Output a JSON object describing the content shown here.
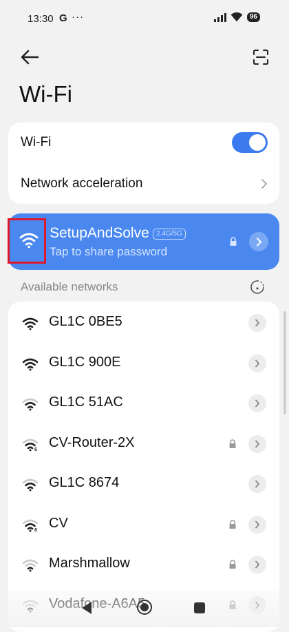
{
  "status_bar": {
    "time": "13:30",
    "carrier_icon": "G",
    "more": "···",
    "battery": "96"
  },
  "header": {
    "back_icon": "arrow-left-icon",
    "scan_icon": "scan-icon",
    "title": "Wi-Fi"
  },
  "settings": {
    "wifi_label": "Wi-Fi",
    "wifi_enabled": true,
    "acceleration_label": "Network acceleration"
  },
  "connected": {
    "name": "SetupAndSolve",
    "band": "2.4G/5G",
    "subtitle": "Tap to share password"
  },
  "available": {
    "header": "Available networks",
    "networks": [
      {
        "name": "GL1C 0BE5",
        "secured": false,
        "wifi6": false,
        "signal": "full"
      },
      {
        "name": "GL1C 900E",
        "secured": false,
        "wifi6": false,
        "signal": "full"
      },
      {
        "name": "GL1C 51AC",
        "secured": false,
        "wifi6": false,
        "signal": "medium"
      },
      {
        "name": "CV-Router-2X",
        "secured": true,
        "wifi6": true,
        "signal": "medium"
      },
      {
        "name": "GL1C 8674",
        "secured": false,
        "wifi6": false,
        "signal": "medium"
      },
      {
        "name": "CV",
        "secured": true,
        "wifi6": true,
        "signal": "medium"
      },
      {
        "name": "Marshmallow",
        "secured": true,
        "wifi6": false,
        "signal": "low"
      },
      {
        "name": "Vodafone-A6A5",
        "secured": true,
        "wifi6": false,
        "signal": "low"
      }
    ]
  },
  "colors": {
    "accent": "#3b7bef",
    "connected_bg": "#4a88f0",
    "highlight": "#e0162b",
    "background": "#f2f2f2"
  }
}
